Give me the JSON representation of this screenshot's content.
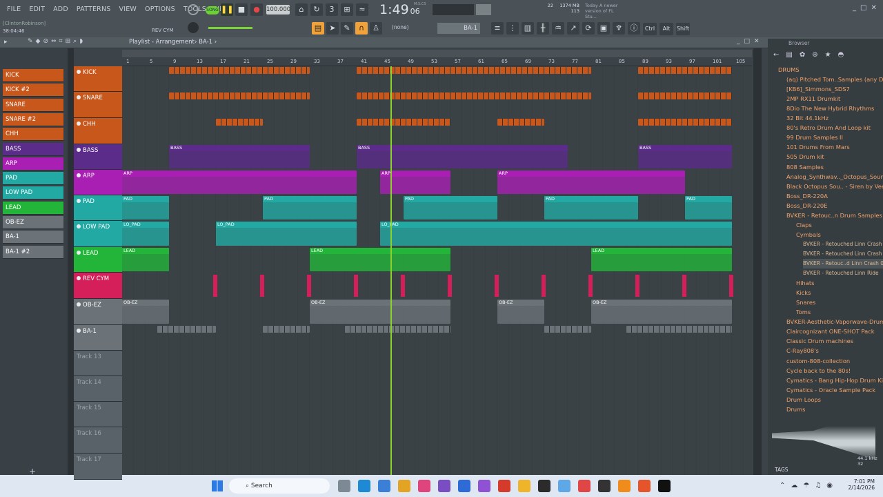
{
  "menu": [
    "FILE",
    "EDIT",
    "ADD",
    "PATTERNS",
    "VIEW",
    "OPTIONS",
    "TOOLS",
    "HELP"
  ],
  "transport": {
    "song": "SONG",
    "tempo": "100.000",
    "time": "1:49",
    "time_sub": "06",
    "time_unit": "M:S:CS",
    "cpu": "22",
    "mem": "1374 MB",
    "poly": "113",
    "news": "Today  A newer version of FL Stu..."
  },
  "hint": {
    "user": "[ClintonRobinson]",
    "time": "38:04:46",
    "channel": "REV CYM"
  },
  "snap": "(none)",
  "pattern": "BA-1",
  "keys": [
    "Ctrl",
    "Alt",
    "Shift"
  ],
  "window": {
    "title": "Playlist - Arrangement",
    "crumb": "BA-1"
  },
  "picker": [
    "KICK",
    "KICK #2",
    "SNARE",
    "SNARE #2",
    "CHH",
    "BASS",
    "ARP",
    "PAD",
    "LOW PAD",
    "LEAD",
    "OB-EZ",
    "BA-1",
    "BA-1 #2"
  ],
  "picker_colors": [
    "#c8571c",
    "#c8571c",
    "#c8571c",
    "#c8571c",
    "#c8571c",
    "#5b2c8a",
    "#a91fb3",
    "#23a9a3",
    "#23a9a3",
    "#23b43a",
    "#6b7378",
    "#6b7378",
    "#6b7378"
  ],
  "ruler": [
    "1",
    "5",
    "9",
    "13",
    "17",
    "21",
    "25",
    "29",
    "33",
    "37",
    "41",
    "45",
    "49",
    "53",
    "57",
    "61",
    "65",
    "69",
    "73",
    "77",
    "81",
    "85",
    "89",
    "93",
    "97",
    "101",
    "105"
  ],
  "tracks": [
    {
      "name": "KICK",
      "color": "#c8571c",
      "h": 37
    },
    {
      "name": "SNARE",
      "color": "#c8571c",
      "h": 38
    },
    {
      "name": "CHH",
      "color": "#c8571c",
      "h": 38
    },
    {
      "name": "BASS",
      "color": "#5b2c8a",
      "h": 37
    },
    {
      "name": "ARP",
      "color": "#a91fb3",
      "h": 37
    },
    {
      "name": "PAD",
      "color": "#23a9a3",
      "h": 37
    },
    {
      "name": "LOW PAD",
      "color": "#23a9a3",
      "h": 38
    },
    {
      "name": "LEAD",
      "color": "#23b43a",
      "h": 37
    },
    {
      "name": "REV CYM",
      "color": "#d41f5a",
      "h": 38
    },
    {
      "name": "OB-EZ",
      "color": "#6b7378",
      "h": 38
    },
    {
      "name": "BA-1",
      "color": "#6b7378",
      "h": 37
    },
    {
      "name": "Track 13",
      "color": "#596268",
      "h": 37
    },
    {
      "name": "Track 14",
      "color": "#596268",
      "h": 37
    },
    {
      "name": "Track 15",
      "color": "#596268",
      "h": 37
    },
    {
      "name": "Track 16",
      "color": "#596268",
      "h": 38
    },
    {
      "name": "Track 17",
      "color": "#596268",
      "h": 38
    }
  ],
  "clip_labels": {
    "BASS": "BASS",
    "ARP": "ARP",
    "PAD": "PAD",
    "LOW PAD": "LO_PAD",
    "LEAD": "LEAD",
    "OB-EZ": "OB-EZ"
  },
  "browser": {
    "title": "Browser",
    "tags": "TAGS",
    "sr": "44.1 kHz 32",
    "items": [
      "DRUMS",
      "(aq) Pitched Tom..Samples (any DAW)",
      "[KB6]_Simmons_SDS7",
      "2MP RX11 Drumkit",
      "8Dio The New Hybrid Rhythms",
      "32 Bit 44.1kHz",
      "80's Retro Drum And Loop kit",
      "99 Drum Samples II",
      "101 Drums From Mars",
      "505 Drum kit",
      "808 Samples",
      "Analog_Synthwav.._Octopus_Sound",
      "Black Octopus Sou.. - Siren by Veela",
      "Boss_DR-220A",
      "Boss_DR-220E",
      "BVKER - Retouc..n Drum Samples",
      "Claps",
      "Cymbals",
      "BVKER - Retouched Linn Crash 01",
      "BVKER - Retouched Linn Crash 02",
      "BVKER - Retouc..d Linn Crash 03",
      "BVKER - Retouched Linn Ride",
      "Hihats",
      "Kicks",
      "Snares",
      "Toms",
      "BVKER-Aesthetic-Vaporwave-Drums",
      "Claircognizant ONE-SHOT Pack",
      "Classic Drum machines",
      "C-Ray808's",
      "custom-808-collection",
      "Cycle back to the 80s!",
      "Cymatics - Bang Hip-Hop Drum Kit",
      "Cymatics - Oracle Sample Pack",
      "Drum Loops",
      "Drums"
    ]
  },
  "taskbar": {
    "search": "Search",
    "time": "7:01 PM",
    "date": "2/14/2026"
  }
}
